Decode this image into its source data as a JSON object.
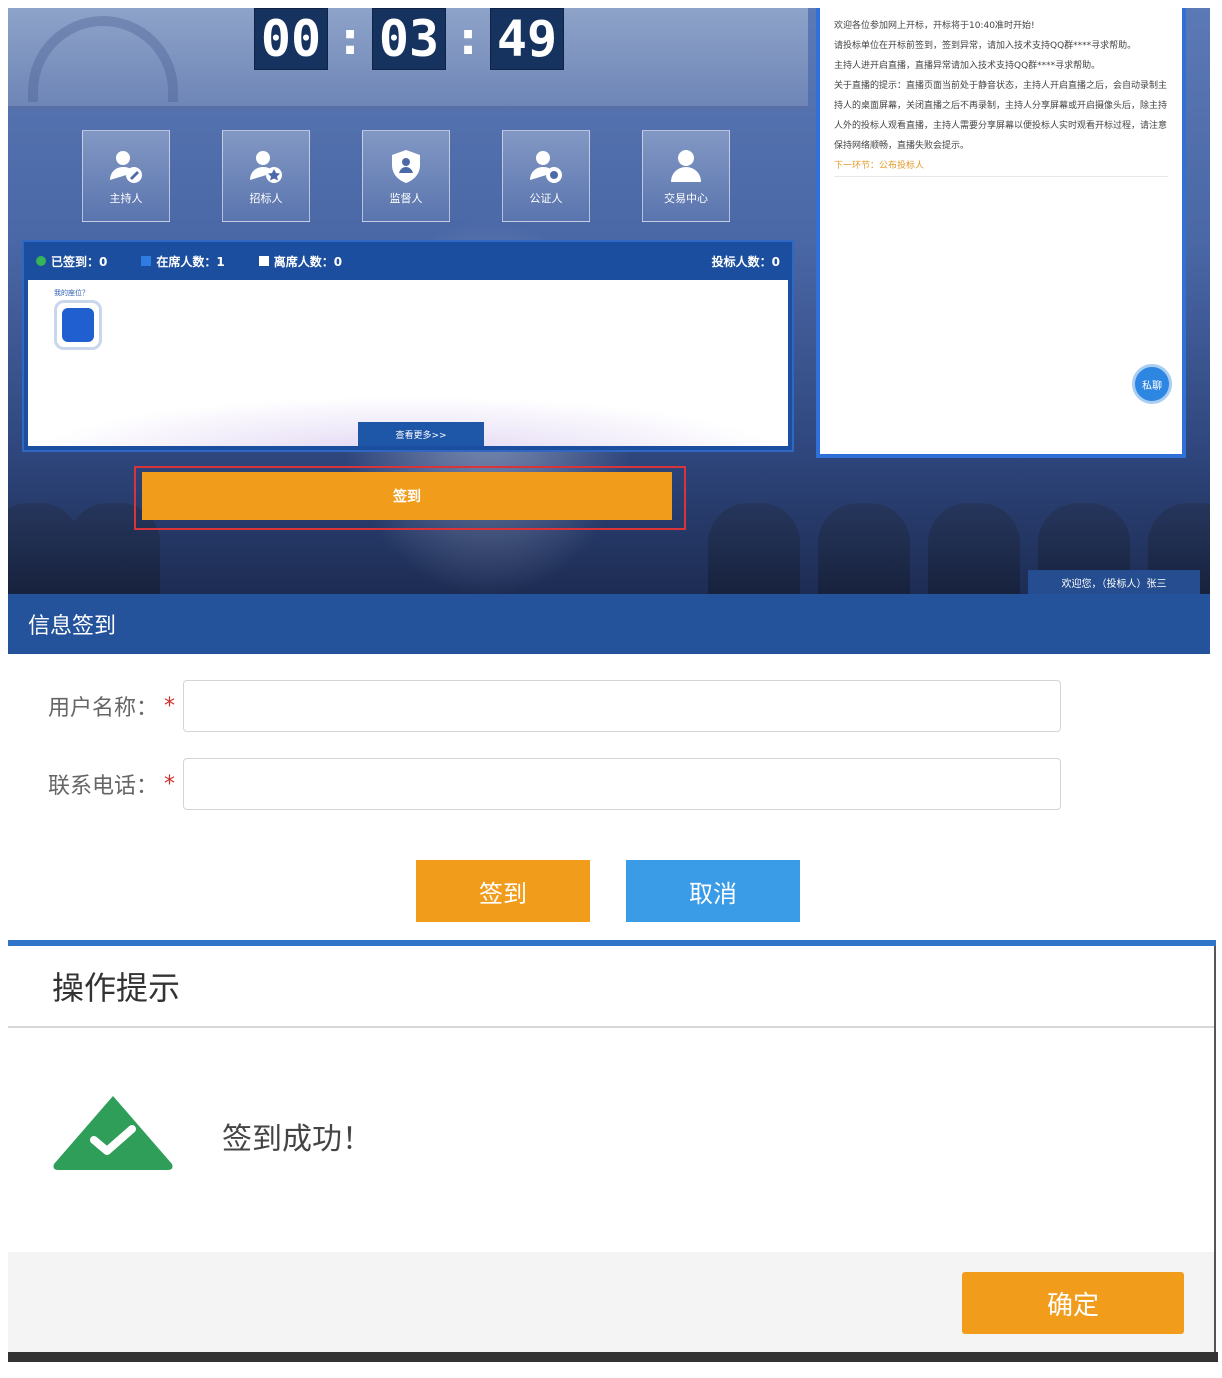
{
  "timer": {
    "hours": "00",
    "minutes": "03",
    "seconds": "49",
    "separator": ":"
  },
  "roles": [
    {
      "label": "主持人",
      "icon": "user-edit-icon"
    },
    {
      "label": "招标人",
      "icon": "user-star-icon"
    },
    {
      "label": "监督人",
      "icon": "shield-user-icon"
    },
    {
      "label": "公证人",
      "icon": "user-seal-icon"
    },
    {
      "label": "交易中心",
      "icon": "user-icon"
    }
  ],
  "stats": {
    "signed": "已签到：0",
    "online": "在席人数：1",
    "away": "离席人数：0",
    "bidders": "投标人数：0"
  },
  "seat_tag": "我的座位？",
  "more_button": "查看更多>>",
  "top_sign_button": "签到",
  "messages": {
    "lines": [
      "欢迎各位参加网上开标，开标将于10:40准时开始!",
      "请投标单位在开标前签到，签到异常，请加入技术支持QQ群****寻求帮助。",
      "主持人进开启直播，直播异常请加入技术支持QQ群****寻求帮助。",
      "关于直播的提示：直播页面当前处于静音状态，主持人开启直播之后，会自动录制主持人的桌面屏幕，关闭直播之后不再录制，主持人分享屏幕或开启摄像头后，除主持人外的投标人观看直播，主持人需要分享屏幕以便投标人实时观看开标过程，请注意保持网络顺畅，直播失败会提示。"
    ],
    "next_link": "下一环节：公布投标人",
    "chat_button": "私聊"
  },
  "welcome": "欢迎您，（投标人）张三",
  "form": {
    "title": "信息签到",
    "username_label": "用户名称：",
    "phone_label": "联系电话：",
    "required_mark": "*",
    "username_value": "",
    "phone_value": "",
    "submit_button": "签到",
    "cancel_button": "取消"
  },
  "dialog": {
    "title": "操作提示",
    "message": "签到成功！",
    "icon": "success-check-icon",
    "ok_button": "确定"
  },
  "colors": {
    "primary_blue": "#24539b",
    "accent_orange": "#f29c1c",
    "cancel_blue": "#3a9be6",
    "success_green": "#2e9e59",
    "required_red": "#d0312d"
  }
}
